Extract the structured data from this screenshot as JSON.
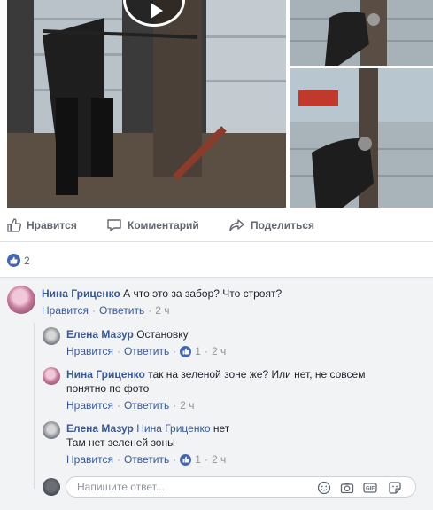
{
  "post_actions": {
    "like_label": "Нравится",
    "comment_label": "Комментарий",
    "share_label": "Поделиться"
  },
  "reactions": {
    "count": "2"
  },
  "comments": [
    {
      "author": "Нина Гриценко",
      "text": "А что это за забор? Что строят?",
      "like_label": "Нравится",
      "reply_label": "Ответить",
      "time": "2 ч"
    },
    {
      "author": "Елена Мазур",
      "text": "Остановку",
      "like_label": "Нравится",
      "reply_label": "Ответить",
      "likes": "1",
      "time": "2 ч"
    },
    {
      "author": "Нина Гриценко",
      "text": "так на зеленой зоне же? Или нет, не совсем",
      "text_line2": "понятно по фото",
      "like_label": "Нравится",
      "reply_label": "Ответить",
      "time": "2 ч"
    },
    {
      "author": "Елена Мазур",
      "mention": "Нина Гриценко",
      "text": "нет",
      "text_line2": "Там нет зеленей зоны",
      "like_label": "Нравится",
      "reply_label": "Ответить",
      "likes": "1",
      "time": "2 ч"
    }
  ],
  "reply": {
    "placeholder": "Напишите ответ..."
  },
  "icons": {
    "like": "thumbs-up-icon",
    "comment": "speech-bubble-icon",
    "share": "share-arrow-icon",
    "emoji": "smiley-icon",
    "camera": "camera-icon",
    "gif": "gif-icon",
    "sticker": "sticker-icon"
  },
  "colors": {
    "link": "#385898",
    "like_badge": "#4267b2",
    "muted": "#90949c"
  }
}
